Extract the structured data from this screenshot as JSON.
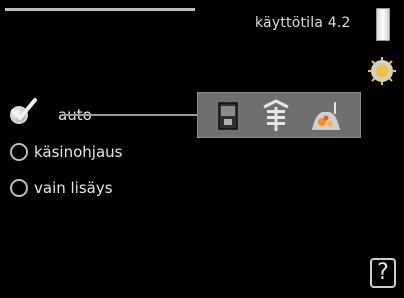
{
  "header": {
    "title": "käyttötila 4.2",
    "tab_icon": "sun-settings-icon"
  },
  "modes": {
    "options": [
      {
        "label": "auto",
        "selected": true
      },
      {
        "label": "käsinohjaus",
        "selected": false
      },
      {
        "label": "vain lisäys",
        "selected": false
      }
    ],
    "selected_icon": "checkmark-icon"
  },
  "panel": {
    "icons": [
      "heat-pump-unit-icon",
      "radiator-icon",
      "heating-ember-icon"
    ]
  },
  "help": {
    "label": "?"
  },
  "colors": {
    "background": "#000000",
    "panel": "#6f6f6f",
    "text": "#e6e6e6"
  }
}
